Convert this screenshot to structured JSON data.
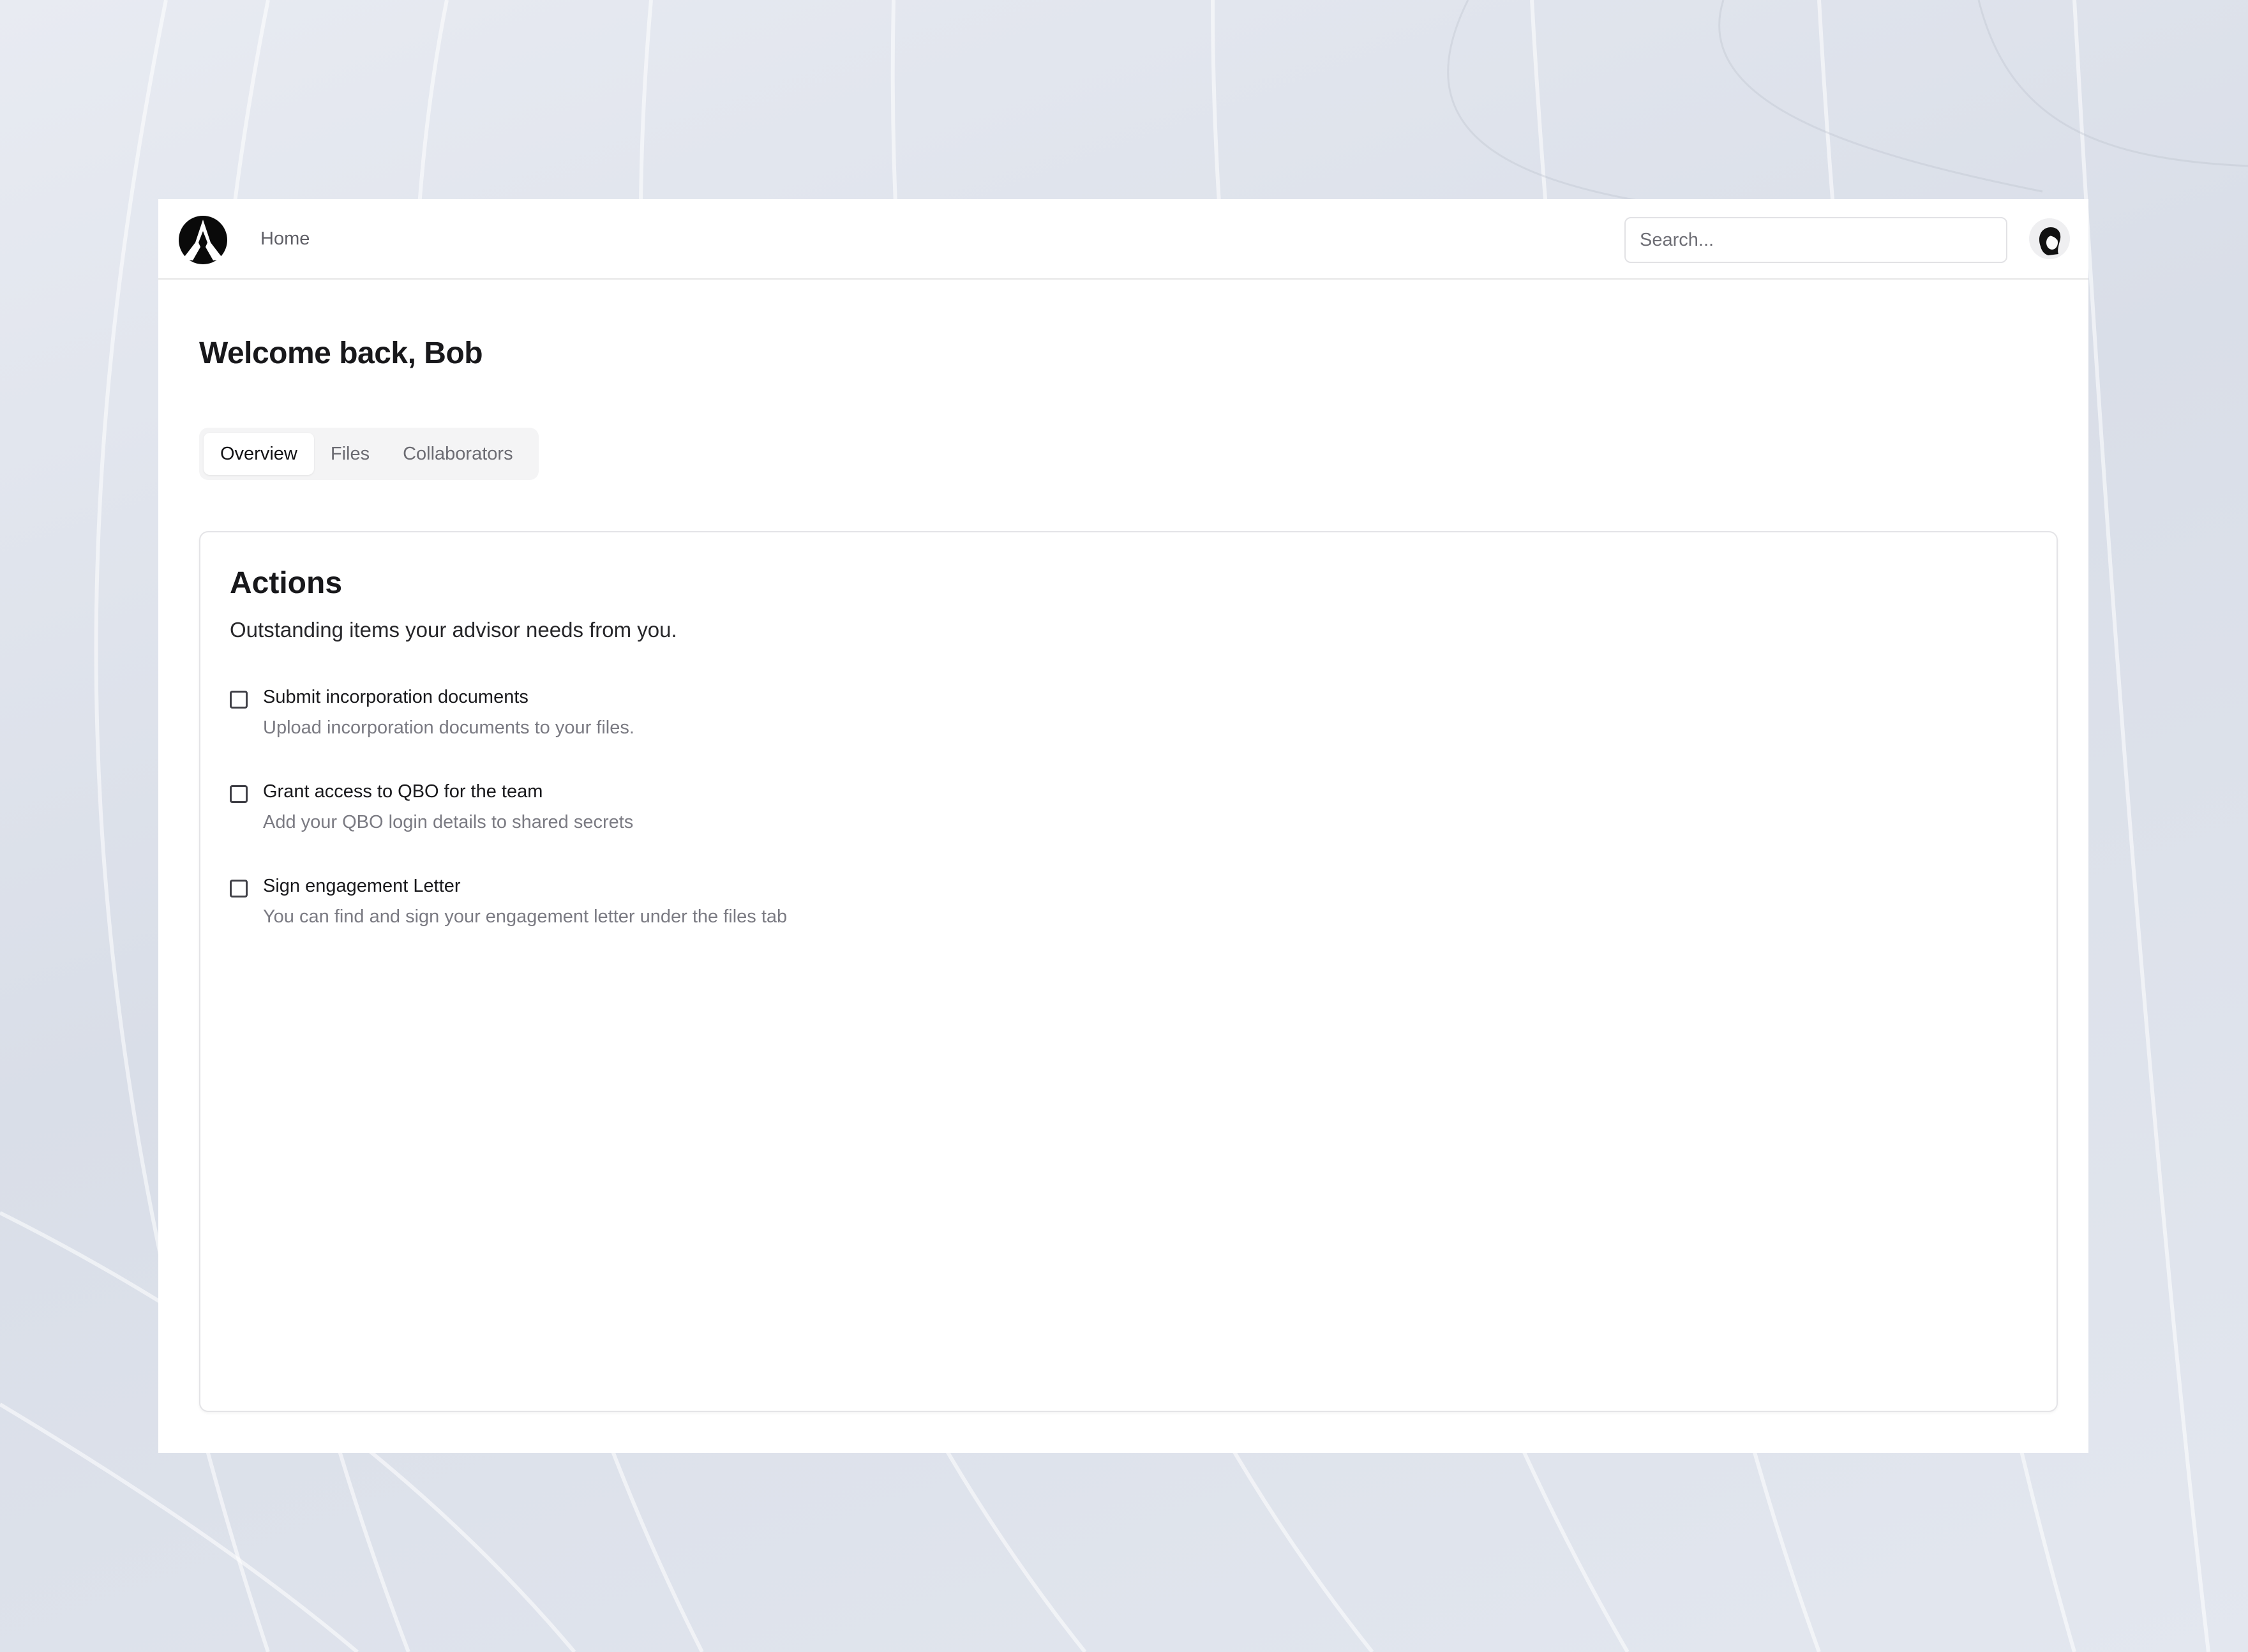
{
  "nav": {
    "home_label": "Home",
    "search_placeholder": "Search..."
  },
  "page": {
    "title": "Welcome back, Bob"
  },
  "tabs": [
    {
      "label": "Overview",
      "active": true
    },
    {
      "label": "Files",
      "active": false
    },
    {
      "label": "Collaborators",
      "active": false
    }
  ],
  "actions_card": {
    "title": "Actions",
    "description": "Outstanding items your advisor needs from you.",
    "items": [
      {
        "title": "Submit incorporation documents",
        "subtitle": "Upload incorporation documents to your files.",
        "checked": false
      },
      {
        "title": "Grant access to QBO for the team",
        "subtitle": "Add your QBO login details to shared secrets",
        "checked": false
      },
      {
        "title": "Sign engagement Letter",
        "subtitle": "You can find and sign your engagement letter under the files tab",
        "checked": false
      }
    ]
  },
  "icons": {
    "logo": "brand-logo-icon",
    "avatar": "user-avatar-icon"
  },
  "colors": {
    "backdrop": "#dde2ec",
    "text_primary": "#18181b",
    "text_muted": "#7a7a82",
    "tab_track": "#f4f4f5"
  }
}
